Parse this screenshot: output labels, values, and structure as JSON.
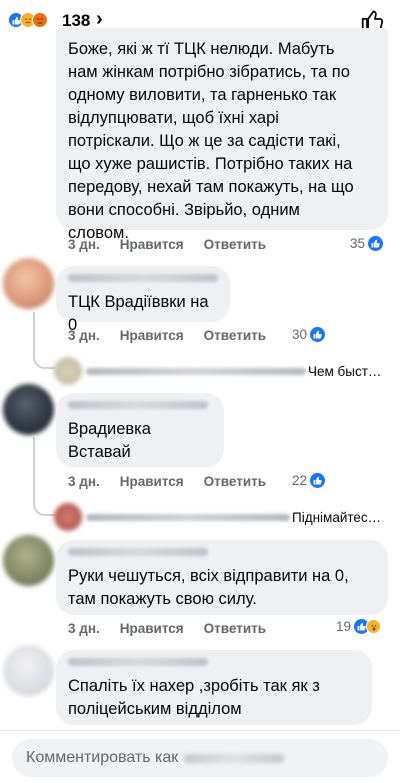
{
  "header": {
    "reaction_count": "138",
    "chevron": "›"
  },
  "labels": {
    "time": "3 дн.",
    "like": "Нравится",
    "reply": "Ответить"
  },
  "comments": [
    {
      "text": "Боже, які ж тї ТЦК нелюди. Мабуть\nнам жінкам потрібно зібратись, та по\nодному виловити, та гарненько так\nвідлупцювати, щоб їхні харі\nпотріскали. Що ж це за садісти такі,\nщо хуже рашистів. Потрібно таких на\nпередову, нехай там покажуть, на що\nвони способні. Звірьйо, одним\nсловом.",
      "reactions": "35"
    },
    {
      "text": "ТЦК Врадіїввки на 0",
      "reactions": "30",
      "reply_preview": "Чем быст…"
    },
    {
      "text": "Врадиевка\nВставай",
      "reactions": "22",
      "reply_preview": "Піднімайтес…"
    },
    {
      "text": "Руки чешуться, всіх відправити на 0,\nтам покажуть свою силу.",
      "reactions": "19"
    },
    {
      "text": "Спаліть їх нахер ,зробіть так як з\nполіцейським відділом"
    }
  ],
  "composer": {
    "placeholder": "Комментировать как"
  },
  "colors": {
    "like_blue": "#1877f2",
    "bubble_bg": "#eef0f3",
    "meta_gray": "#65676b"
  }
}
